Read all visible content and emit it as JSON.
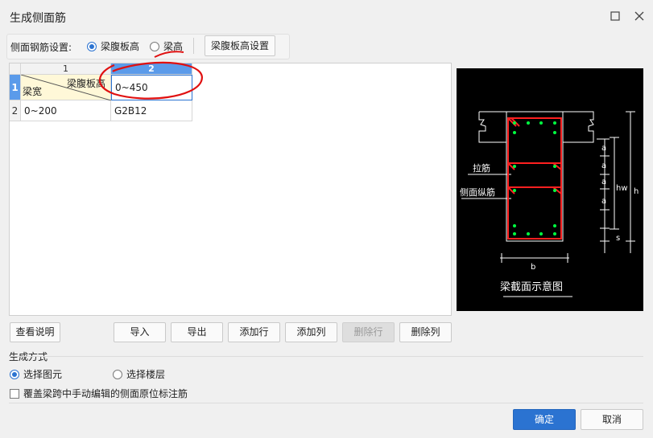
{
  "window": {
    "title": "生成侧面筋",
    "maximize_icon": "square-icon",
    "close_icon": "close-icon"
  },
  "settings": {
    "label": "侧面钢筋设置:",
    "option_web_height": "梁腹板高",
    "option_beam_height": "梁高",
    "selected": "梁腹板高",
    "web_height_button": "梁腹板高设置"
  },
  "grid": {
    "col_headers": [
      "1",
      "2"
    ],
    "row_headers": [
      "1",
      "2"
    ],
    "corner_top_label": "梁腹板高",
    "corner_bottom_label": "梁宽",
    "height_ranges": [
      "0~450"
    ],
    "rows": [
      {
        "width_range": "0~200",
        "value": "G2B12"
      }
    ]
  },
  "diagram": {
    "label_tie": "拉筋",
    "label_side_bar": "侧面纵筋",
    "caption": "梁截面示意图",
    "dim_a": "a",
    "dim_hw": "hw",
    "dim_h": "h",
    "dim_s": "s",
    "dim_b": "b",
    "colors": {
      "background": "#000000",
      "stirrup": "#ff2020",
      "rebar": "#00ff40",
      "lines": "#ffffff"
    }
  },
  "actions": {
    "view_notes": "查看说明",
    "import": "导入",
    "export": "导出",
    "add_row": "添加行",
    "add_col": "添加列",
    "delete_row": "删除行",
    "delete_col": "删除列"
  },
  "generation": {
    "section_label": "生成方式",
    "option_select_element": "选择图元",
    "option_select_floor": "选择楼层",
    "selected": "选择图元",
    "overwrite_label": "覆盖梁跨中手动编辑的侧面原位标注筋",
    "overwrite_checked": false
  },
  "footer": {
    "ok": "确定",
    "cancel": "取消"
  },
  "theme": {
    "accent": "#2b73d1",
    "annotation": "#e01010"
  }
}
